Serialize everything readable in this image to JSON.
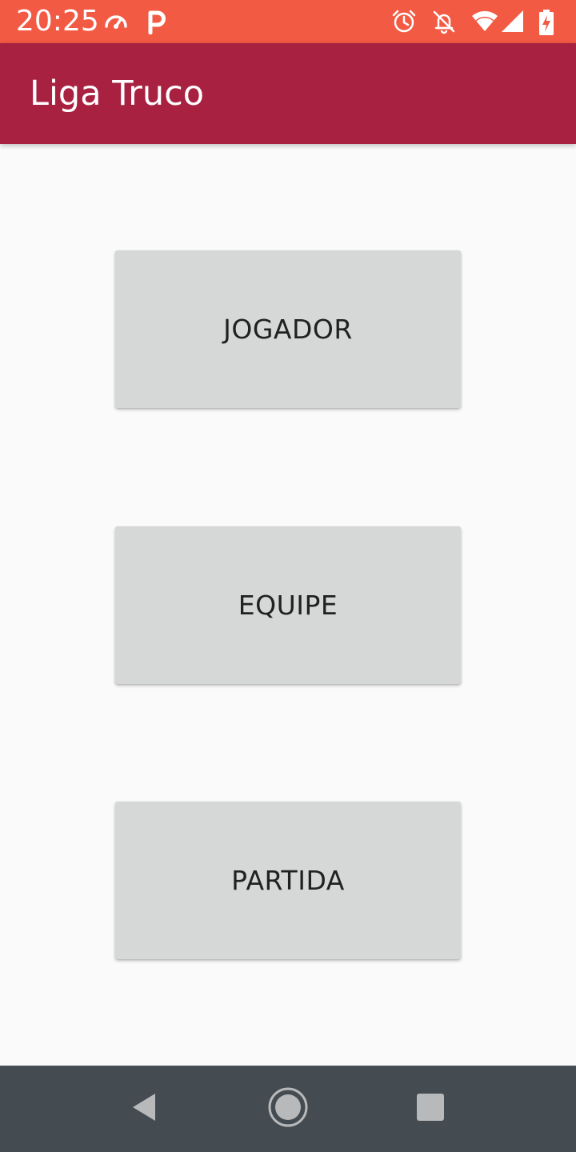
{
  "status_bar": {
    "time": "20:25",
    "left_icons": [
      "speedometer-icon",
      "parking-icon"
    ],
    "right_icons": [
      "alarm-icon",
      "notifications-off-icon",
      "wifi-icon",
      "signal-icon",
      "battery-charging-icon"
    ],
    "background": "#f25a44"
  },
  "app_bar": {
    "title": "Liga Truco",
    "background": "#a82141"
  },
  "main": {
    "buttons": [
      {
        "label": "JOGADOR"
      },
      {
        "label": "EQUIPE"
      },
      {
        "label": "PARTIDA"
      }
    ],
    "button_color": "#d6d7d7"
  },
  "nav_bar": {
    "icons": [
      "back-icon",
      "home-icon",
      "recents-icon"
    ],
    "background": "#444b51"
  }
}
